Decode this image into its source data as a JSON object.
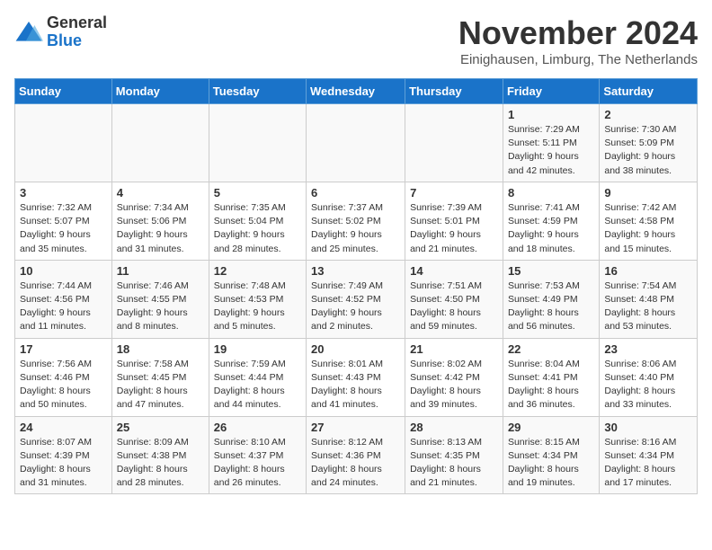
{
  "header": {
    "logo_general": "General",
    "logo_blue": "Blue",
    "month_title": "November 2024",
    "location": "Einighausen, Limburg, The Netherlands"
  },
  "days_of_week": [
    "Sunday",
    "Monday",
    "Tuesday",
    "Wednesday",
    "Thursday",
    "Friday",
    "Saturday"
  ],
  "weeks": [
    [
      {
        "day": "",
        "info": ""
      },
      {
        "day": "",
        "info": ""
      },
      {
        "day": "",
        "info": ""
      },
      {
        "day": "",
        "info": ""
      },
      {
        "day": "",
        "info": ""
      },
      {
        "day": "1",
        "info": "Sunrise: 7:29 AM\nSunset: 5:11 PM\nDaylight: 9 hours and 42 minutes."
      },
      {
        "day": "2",
        "info": "Sunrise: 7:30 AM\nSunset: 5:09 PM\nDaylight: 9 hours and 38 minutes."
      }
    ],
    [
      {
        "day": "3",
        "info": "Sunrise: 7:32 AM\nSunset: 5:07 PM\nDaylight: 9 hours and 35 minutes."
      },
      {
        "day": "4",
        "info": "Sunrise: 7:34 AM\nSunset: 5:06 PM\nDaylight: 9 hours and 31 minutes."
      },
      {
        "day": "5",
        "info": "Sunrise: 7:35 AM\nSunset: 5:04 PM\nDaylight: 9 hours and 28 minutes."
      },
      {
        "day": "6",
        "info": "Sunrise: 7:37 AM\nSunset: 5:02 PM\nDaylight: 9 hours and 25 minutes."
      },
      {
        "day": "7",
        "info": "Sunrise: 7:39 AM\nSunset: 5:01 PM\nDaylight: 9 hours and 21 minutes."
      },
      {
        "day": "8",
        "info": "Sunrise: 7:41 AM\nSunset: 4:59 PM\nDaylight: 9 hours and 18 minutes."
      },
      {
        "day": "9",
        "info": "Sunrise: 7:42 AM\nSunset: 4:58 PM\nDaylight: 9 hours and 15 minutes."
      }
    ],
    [
      {
        "day": "10",
        "info": "Sunrise: 7:44 AM\nSunset: 4:56 PM\nDaylight: 9 hours and 11 minutes."
      },
      {
        "day": "11",
        "info": "Sunrise: 7:46 AM\nSunset: 4:55 PM\nDaylight: 9 hours and 8 minutes."
      },
      {
        "day": "12",
        "info": "Sunrise: 7:48 AM\nSunset: 4:53 PM\nDaylight: 9 hours and 5 minutes."
      },
      {
        "day": "13",
        "info": "Sunrise: 7:49 AM\nSunset: 4:52 PM\nDaylight: 9 hours and 2 minutes."
      },
      {
        "day": "14",
        "info": "Sunrise: 7:51 AM\nSunset: 4:50 PM\nDaylight: 8 hours and 59 minutes."
      },
      {
        "day": "15",
        "info": "Sunrise: 7:53 AM\nSunset: 4:49 PM\nDaylight: 8 hours and 56 minutes."
      },
      {
        "day": "16",
        "info": "Sunrise: 7:54 AM\nSunset: 4:48 PM\nDaylight: 8 hours and 53 minutes."
      }
    ],
    [
      {
        "day": "17",
        "info": "Sunrise: 7:56 AM\nSunset: 4:46 PM\nDaylight: 8 hours and 50 minutes."
      },
      {
        "day": "18",
        "info": "Sunrise: 7:58 AM\nSunset: 4:45 PM\nDaylight: 8 hours and 47 minutes."
      },
      {
        "day": "19",
        "info": "Sunrise: 7:59 AM\nSunset: 4:44 PM\nDaylight: 8 hours and 44 minutes."
      },
      {
        "day": "20",
        "info": "Sunrise: 8:01 AM\nSunset: 4:43 PM\nDaylight: 8 hours and 41 minutes."
      },
      {
        "day": "21",
        "info": "Sunrise: 8:02 AM\nSunset: 4:42 PM\nDaylight: 8 hours and 39 minutes."
      },
      {
        "day": "22",
        "info": "Sunrise: 8:04 AM\nSunset: 4:41 PM\nDaylight: 8 hours and 36 minutes."
      },
      {
        "day": "23",
        "info": "Sunrise: 8:06 AM\nSunset: 4:40 PM\nDaylight: 8 hours and 33 minutes."
      }
    ],
    [
      {
        "day": "24",
        "info": "Sunrise: 8:07 AM\nSunset: 4:39 PM\nDaylight: 8 hours and 31 minutes."
      },
      {
        "day": "25",
        "info": "Sunrise: 8:09 AM\nSunset: 4:38 PM\nDaylight: 8 hours and 28 minutes."
      },
      {
        "day": "26",
        "info": "Sunrise: 8:10 AM\nSunset: 4:37 PM\nDaylight: 8 hours and 26 minutes."
      },
      {
        "day": "27",
        "info": "Sunrise: 8:12 AM\nSunset: 4:36 PM\nDaylight: 8 hours and 24 minutes."
      },
      {
        "day": "28",
        "info": "Sunrise: 8:13 AM\nSunset: 4:35 PM\nDaylight: 8 hours and 21 minutes."
      },
      {
        "day": "29",
        "info": "Sunrise: 8:15 AM\nSunset: 4:34 PM\nDaylight: 8 hours and 19 minutes."
      },
      {
        "day": "30",
        "info": "Sunrise: 8:16 AM\nSunset: 4:34 PM\nDaylight: 8 hours and 17 minutes."
      }
    ]
  ]
}
